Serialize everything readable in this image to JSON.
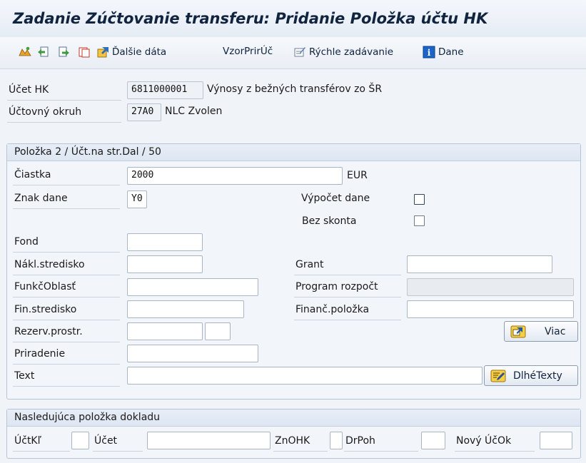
{
  "window": {
    "title": "Zadanie Zúčtovanie transferu: Pridanie Položka účtu HK"
  },
  "toolbar": {
    "buttons": [
      {
        "icon": "overview-icon",
        "label": ""
      },
      {
        "icon": "back-icon",
        "label": ""
      },
      {
        "icon": "forward-icon",
        "label": ""
      },
      {
        "icon": "delete-icon",
        "label": ""
      },
      {
        "icon": "more-data-icon",
        "label": "Ďalšie dáta"
      },
      {
        "icon": "",
        "label": "VzorPrirÚč"
      },
      {
        "icon": "fast-entry-icon",
        "label": "Rýchle zadávanie"
      },
      {
        "icon": "info-icon",
        "label": "Dane"
      }
    ]
  },
  "header": {
    "account_label": "Účet HK",
    "account_value": "6811000001",
    "account_desc": "Výnosy z bežných transférov zo ŠR",
    "company_label": "Účtovný okruh",
    "company_value": "27A0",
    "company_desc": "NLC Zvolen"
  },
  "item_section": {
    "title": "Položka 2 / Účt.na str.Dal / 50",
    "amount_label": "Čiastka",
    "amount_value": "2000",
    "currency": "EUR",
    "tax_code_label": "Znak dane",
    "tax_code_value": "Y0",
    "calc_tax_label": "Výpočet dane",
    "no_discount_label": "Bez skonta",
    "fund_label": "Fond",
    "cost_center_label": "Nákl.stredisko",
    "grant_label": "Grant",
    "func_area_label": "FunkčOblasť",
    "budget_program_label": "Program rozpočt",
    "fund_center_label": "Fin.stredisko",
    "commitment_item_label": "Finanč.položka",
    "earmarked_label": "Rezerv.prostr.",
    "more_button": "Viac",
    "assignment_label": "Priradenie",
    "text_label": "Text",
    "long_texts_button": "DlhéTexty"
  },
  "next_item": {
    "title": "Nasledujúca položka dokladu",
    "posting_key_label": "ÚčtKľ",
    "account_label": "Účet",
    "sp_gl_label": "ZnOHK",
    "trans_type_label": "DrPoh",
    "new_company_label": "Nový ÚčOk"
  }
}
